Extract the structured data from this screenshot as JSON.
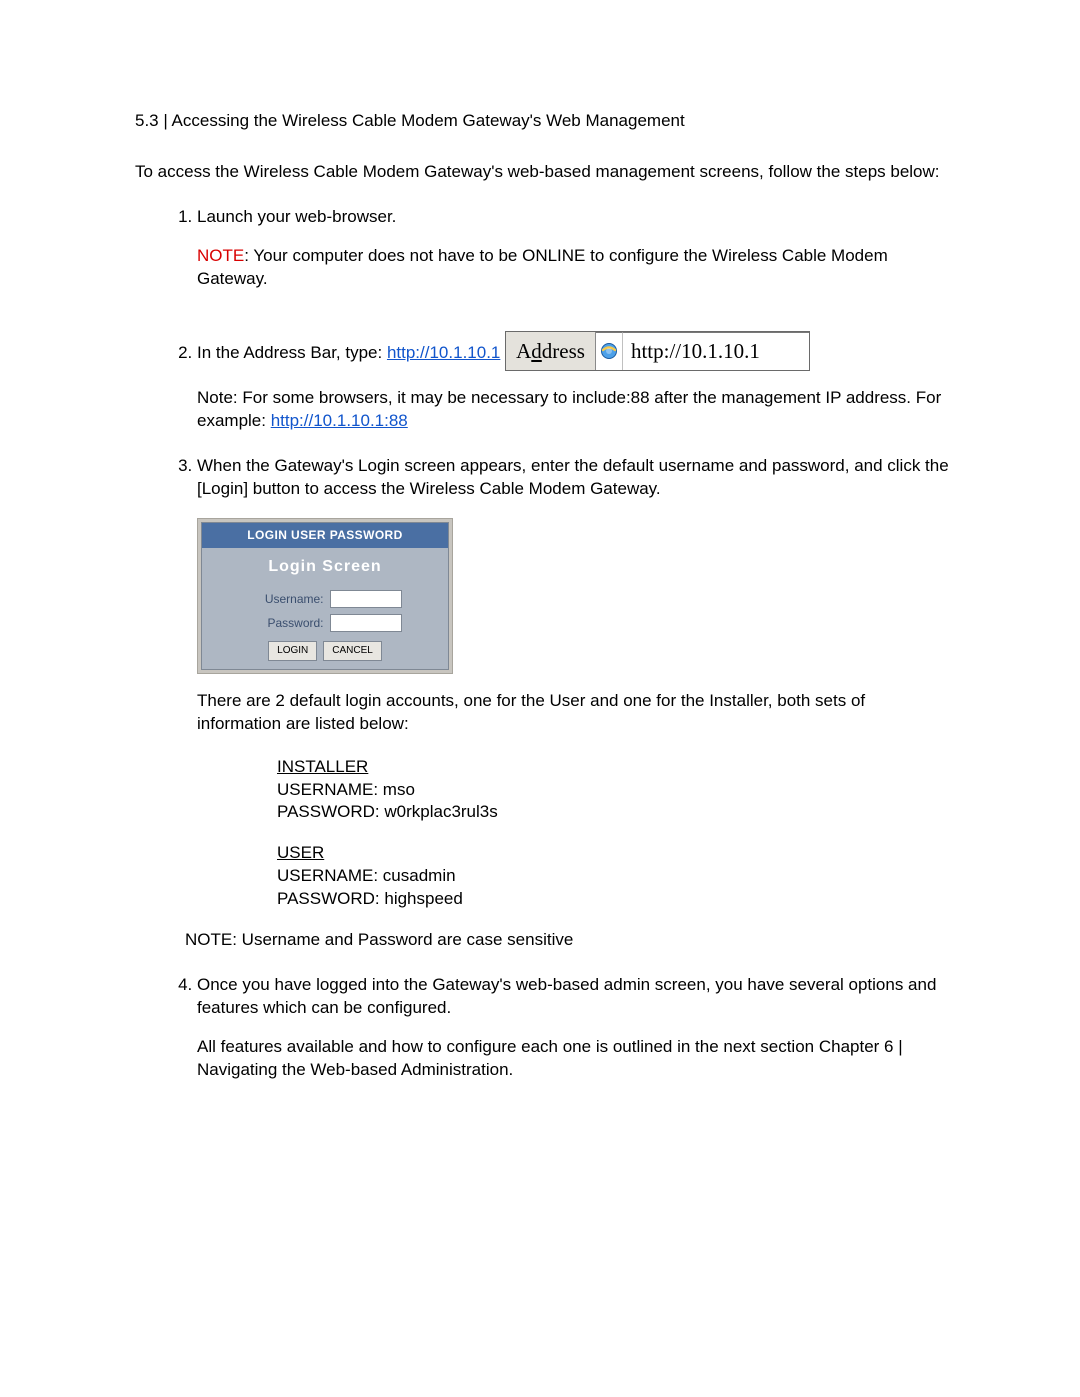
{
  "heading": "5.3 |  Accessing the Wireless Cable Modem Gateway's Web Management",
  "intro": "To access the Wireless Cable Modem Gateway's web-based management screens, follow the steps below:",
  "step1": {
    "text": "Launch your web-browser.",
    "note_label": "NOTE",
    "note_text": ": Your computer does not have to be ONLINE to configure the Wireless Cable Modem Gateway."
  },
  "step2": {
    "lead": "In the Address Bar, type: ",
    "url": "http://10.1.10.1",
    "addr_label_pre": "A",
    "addr_label_ul": "d",
    "addr_label_post": "dress",
    "addr_url_display": "http://10.1.10.1",
    "note_pre": "Note: For some browsers, it may be necessary to include:88 after the management IP address. For example: ",
    "note_url": "http://10.1.10.1:88"
  },
  "step3": {
    "text": "When the Gateway's Login screen appears, enter the default username and password, and click the [Login] button to access the Wireless Cable Modem Gateway.",
    "login_bar": "LOGIN USER PASSWORD",
    "login_title": "Login  Screen",
    "username_label": "Username:",
    "password_label": "Password:",
    "login_btn": "LOGIN",
    "cancel_btn": "CANCEL",
    "after_text": "There are 2 default login accounts, one for the User and one for the Installer, both sets of information are listed below:",
    "installer_heading": "INSTALLER",
    "installer_user": "USERNAME: mso",
    "installer_pass": "PASSWORD: w0rkplac3rul3s",
    "user_heading": "USER",
    "user_user": "USERNAME: cusadmin",
    "user_pass": "PASSWORD: highspeed",
    "case_note": "NOTE: Username and Password are case sensitive"
  },
  "step4": {
    "text1": "Once you have logged into the Gateway's web-based admin screen, you have several options and features which can be configured.",
    "text2": "All features available and how to configure each one is outlined in the next section Chapter 6 |  Navigating the Web-based Administration."
  }
}
